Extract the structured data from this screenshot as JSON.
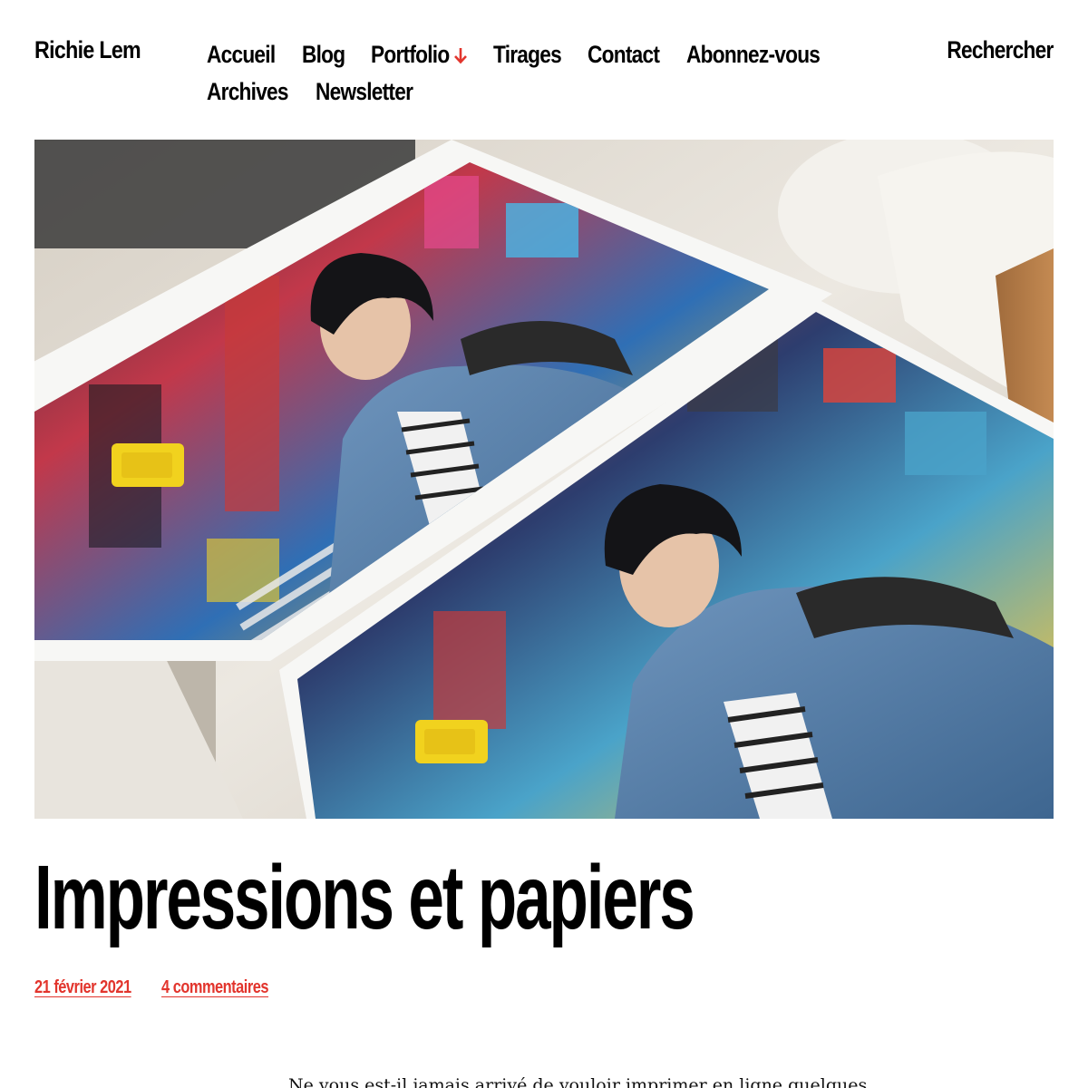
{
  "header": {
    "site_title": "Richie Lem",
    "search_label": "Rechercher"
  },
  "nav": {
    "items": [
      {
        "label": "Accueil"
      },
      {
        "label": "Blog"
      },
      {
        "label": "Portfolio",
        "has_dropdown": true
      },
      {
        "label": "Tirages"
      },
      {
        "label": "Contact"
      },
      {
        "label": "Abonnez-vous"
      },
      {
        "label": "Archives"
      },
      {
        "label": "Newsletter"
      }
    ]
  },
  "post": {
    "title": "Impressions et papiers",
    "date": "21 février 2021",
    "comments": "4 commentaires",
    "excerpt": "Ne vous est-il jamais arrivé de vouloir imprimer en ligne quelques"
  },
  "colors": {
    "accent": "#e2352d",
    "text": "#000000",
    "background": "#ffffff"
  },
  "icons": {
    "dropdown": "arrow-down-icon"
  }
}
